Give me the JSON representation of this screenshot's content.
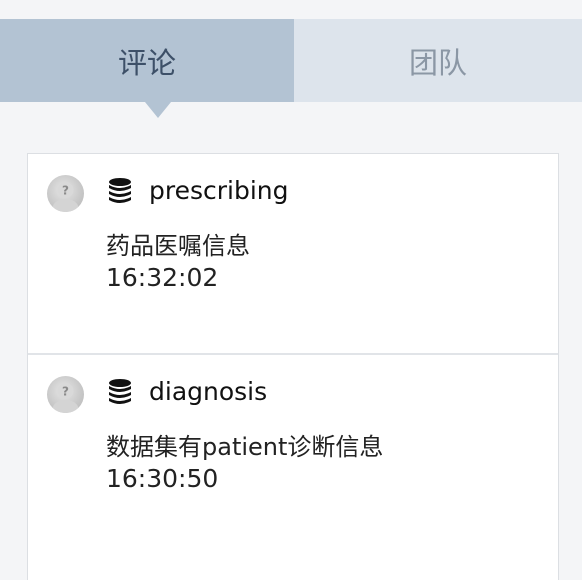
{
  "tabs": [
    {
      "label": "评论",
      "active": true
    },
    {
      "label": "团队",
      "active": false
    }
  ],
  "activity": [
    {
      "icon": "database-icon",
      "name": "prescribing",
      "message": "药品医嘱信息",
      "time": "16:32:02"
    },
    {
      "icon": "database-icon",
      "name": "diagnosis",
      "message": "数据集有patient诊断信息",
      "time": "16:30:50"
    }
  ],
  "colors": {
    "active_tab": "#b3c3d3",
    "inactive_tab": "#dde4ec",
    "active_tab_text": "#3d5068",
    "inactive_tab_text": "#8b97a5",
    "background": "#f4f5f7"
  }
}
